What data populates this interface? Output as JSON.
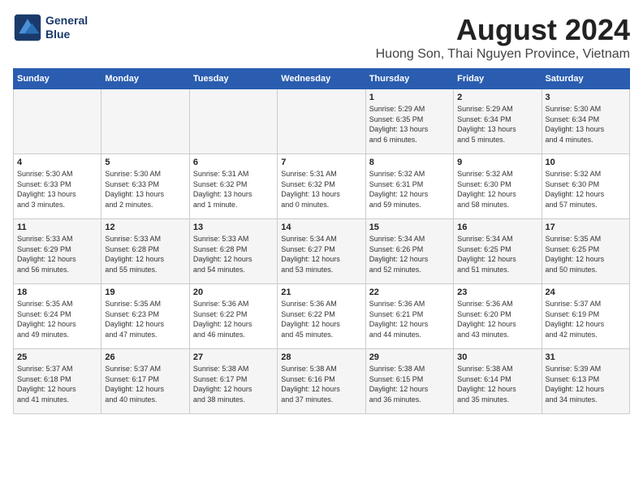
{
  "logo": {
    "line1": "General",
    "line2": "Blue"
  },
  "title": "August 2024",
  "subtitle": "Huong Son, Thai Nguyen Province, Vietnam",
  "header_days": [
    "Sunday",
    "Monday",
    "Tuesday",
    "Wednesday",
    "Thursday",
    "Friday",
    "Saturday"
  ],
  "weeks": [
    [
      {
        "day": "",
        "info": ""
      },
      {
        "day": "",
        "info": ""
      },
      {
        "day": "",
        "info": ""
      },
      {
        "day": "",
        "info": ""
      },
      {
        "day": "1",
        "info": "Sunrise: 5:29 AM\nSunset: 6:35 PM\nDaylight: 13 hours\nand 6 minutes."
      },
      {
        "day": "2",
        "info": "Sunrise: 5:29 AM\nSunset: 6:34 PM\nDaylight: 13 hours\nand 5 minutes."
      },
      {
        "day": "3",
        "info": "Sunrise: 5:30 AM\nSunset: 6:34 PM\nDaylight: 13 hours\nand 4 minutes."
      }
    ],
    [
      {
        "day": "4",
        "info": "Sunrise: 5:30 AM\nSunset: 6:33 PM\nDaylight: 13 hours\nand 3 minutes."
      },
      {
        "day": "5",
        "info": "Sunrise: 5:30 AM\nSunset: 6:33 PM\nDaylight: 13 hours\nand 2 minutes."
      },
      {
        "day": "6",
        "info": "Sunrise: 5:31 AM\nSunset: 6:32 PM\nDaylight: 13 hours\nand 1 minute."
      },
      {
        "day": "7",
        "info": "Sunrise: 5:31 AM\nSunset: 6:32 PM\nDaylight: 13 hours\nand 0 minutes."
      },
      {
        "day": "8",
        "info": "Sunrise: 5:32 AM\nSunset: 6:31 PM\nDaylight: 12 hours\nand 59 minutes."
      },
      {
        "day": "9",
        "info": "Sunrise: 5:32 AM\nSunset: 6:30 PM\nDaylight: 12 hours\nand 58 minutes."
      },
      {
        "day": "10",
        "info": "Sunrise: 5:32 AM\nSunset: 6:30 PM\nDaylight: 12 hours\nand 57 minutes."
      }
    ],
    [
      {
        "day": "11",
        "info": "Sunrise: 5:33 AM\nSunset: 6:29 PM\nDaylight: 12 hours\nand 56 minutes."
      },
      {
        "day": "12",
        "info": "Sunrise: 5:33 AM\nSunset: 6:28 PM\nDaylight: 12 hours\nand 55 minutes."
      },
      {
        "day": "13",
        "info": "Sunrise: 5:33 AM\nSunset: 6:28 PM\nDaylight: 12 hours\nand 54 minutes."
      },
      {
        "day": "14",
        "info": "Sunrise: 5:34 AM\nSunset: 6:27 PM\nDaylight: 12 hours\nand 53 minutes."
      },
      {
        "day": "15",
        "info": "Sunrise: 5:34 AM\nSunset: 6:26 PM\nDaylight: 12 hours\nand 52 minutes."
      },
      {
        "day": "16",
        "info": "Sunrise: 5:34 AM\nSunset: 6:25 PM\nDaylight: 12 hours\nand 51 minutes."
      },
      {
        "day": "17",
        "info": "Sunrise: 5:35 AM\nSunset: 6:25 PM\nDaylight: 12 hours\nand 50 minutes."
      }
    ],
    [
      {
        "day": "18",
        "info": "Sunrise: 5:35 AM\nSunset: 6:24 PM\nDaylight: 12 hours\nand 49 minutes."
      },
      {
        "day": "19",
        "info": "Sunrise: 5:35 AM\nSunset: 6:23 PM\nDaylight: 12 hours\nand 47 minutes."
      },
      {
        "day": "20",
        "info": "Sunrise: 5:36 AM\nSunset: 6:22 PM\nDaylight: 12 hours\nand 46 minutes."
      },
      {
        "day": "21",
        "info": "Sunrise: 5:36 AM\nSunset: 6:22 PM\nDaylight: 12 hours\nand 45 minutes."
      },
      {
        "day": "22",
        "info": "Sunrise: 5:36 AM\nSunset: 6:21 PM\nDaylight: 12 hours\nand 44 minutes."
      },
      {
        "day": "23",
        "info": "Sunrise: 5:36 AM\nSunset: 6:20 PM\nDaylight: 12 hours\nand 43 minutes."
      },
      {
        "day": "24",
        "info": "Sunrise: 5:37 AM\nSunset: 6:19 PM\nDaylight: 12 hours\nand 42 minutes."
      }
    ],
    [
      {
        "day": "25",
        "info": "Sunrise: 5:37 AM\nSunset: 6:18 PM\nDaylight: 12 hours\nand 41 minutes."
      },
      {
        "day": "26",
        "info": "Sunrise: 5:37 AM\nSunset: 6:17 PM\nDaylight: 12 hours\nand 40 minutes."
      },
      {
        "day": "27",
        "info": "Sunrise: 5:38 AM\nSunset: 6:17 PM\nDaylight: 12 hours\nand 38 minutes."
      },
      {
        "day": "28",
        "info": "Sunrise: 5:38 AM\nSunset: 6:16 PM\nDaylight: 12 hours\nand 37 minutes."
      },
      {
        "day": "29",
        "info": "Sunrise: 5:38 AM\nSunset: 6:15 PM\nDaylight: 12 hours\nand 36 minutes."
      },
      {
        "day": "30",
        "info": "Sunrise: 5:38 AM\nSunset: 6:14 PM\nDaylight: 12 hours\nand 35 minutes."
      },
      {
        "day": "31",
        "info": "Sunrise: 5:39 AM\nSunset: 6:13 PM\nDaylight: 12 hours\nand 34 minutes."
      }
    ]
  ]
}
